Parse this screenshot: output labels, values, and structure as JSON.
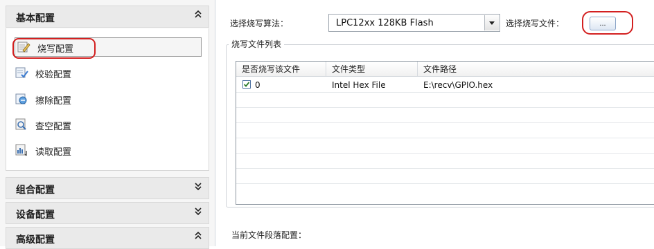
{
  "nav": {
    "basic": {
      "title": "基本配置",
      "chevron": "collapse"
    },
    "items": [
      {
        "label": "烧写配置",
        "icon": "burn-icon",
        "selected": true
      },
      {
        "label": "校验配置",
        "icon": "verify-icon",
        "selected": false
      },
      {
        "label": "擦除配置",
        "icon": "erase-icon",
        "selected": false
      },
      {
        "label": "查空配置",
        "icon": "blank-check-icon",
        "selected": false
      },
      {
        "label": "读取配置",
        "icon": "read-icon",
        "selected": false
      }
    ],
    "combo": {
      "title": "组合配置",
      "chevron": "expand"
    },
    "device": {
      "title": "设备配置",
      "chevron": "expand"
    },
    "advanced": {
      "title": "高级配置",
      "chevron": "collapse"
    }
  },
  "main": {
    "algo_label": "选择烧写算法：",
    "algo_value": "LPC12xx 128KB Flash",
    "file_label": "选择烧写文件：",
    "browse_label": "...",
    "group_title": "烧写文件列表",
    "columns": [
      "是否烧写该文件",
      "文件类型",
      "文件路径"
    ],
    "rows": [
      {
        "checked": true,
        "index": "0",
        "type": "Intel Hex File",
        "path": "E:\\recv\\GPIO.hex"
      }
    ],
    "segment_label": "当前文件段落配置："
  },
  "colors": {
    "highlight_ring": "#d32020",
    "accent": "#4a6fa0"
  }
}
